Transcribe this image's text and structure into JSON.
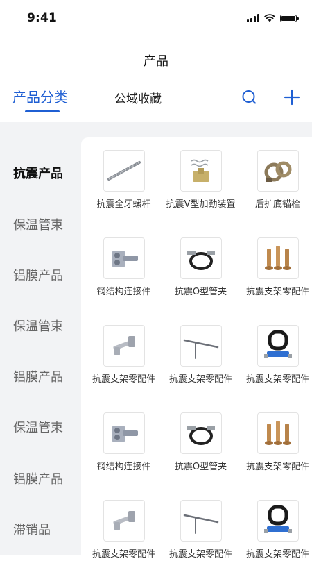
{
  "status_bar": {
    "time": "9:41"
  },
  "page_title": "产品",
  "tabs": [
    {
      "label": "产品分类"
    },
    {
      "label": "公域收藏"
    }
  ],
  "sidebar": {
    "items": [
      {
        "label": "抗震产品"
      },
      {
        "label": "保温管束"
      },
      {
        "label": "铝膜产品"
      },
      {
        "label": "保温管束"
      },
      {
        "label": "铝膜产品"
      },
      {
        "label": "保温管束"
      },
      {
        "label": "铝膜产品"
      },
      {
        "label": "滞销品"
      }
    ]
  },
  "products": [
    {
      "name": "抗震全牙螺杆",
      "icon": "threaded-rod-icon"
    },
    {
      "name": "抗震V型加劲装置",
      "icon": "spring-bracket-icon"
    },
    {
      "name": "后扩底锚栓",
      "icon": "clamp-coupler-icon"
    },
    {
      "name": "钢结构连接件",
      "icon": "steel-connector-icon"
    },
    {
      "name": "抗震O型管夹",
      "icon": "pipe-clamp-icon"
    },
    {
      "name": "抗震支架零配件",
      "icon": "bolts-icon"
    },
    {
      "name": "抗震支架零配件",
      "icon": "hammer-bolt-icon"
    },
    {
      "name": "抗震支架零配件",
      "icon": "rod-icon"
    },
    {
      "name": "抗震支架零配件",
      "icon": "rubber-clamp-icon"
    },
    {
      "name": "钢结构连接件",
      "icon": "steel-connector-icon"
    },
    {
      "name": "抗震O型管夹",
      "icon": "pipe-clamp-icon"
    },
    {
      "name": "抗震支架零配件",
      "icon": "bolts-icon"
    },
    {
      "name": "抗震支架零配件",
      "icon": "hammer-bolt-icon"
    },
    {
      "name": "抗震支架零配件",
      "icon": "rod-icon"
    },
    {
      "name": "抗震支架零配件",
      "icon": "rubber-clamp-icon"
    }
  ],
  "colors": {
    "accent": "#1f5fd3",
    "panel_bg": "#f2f3f5"
  }
}
